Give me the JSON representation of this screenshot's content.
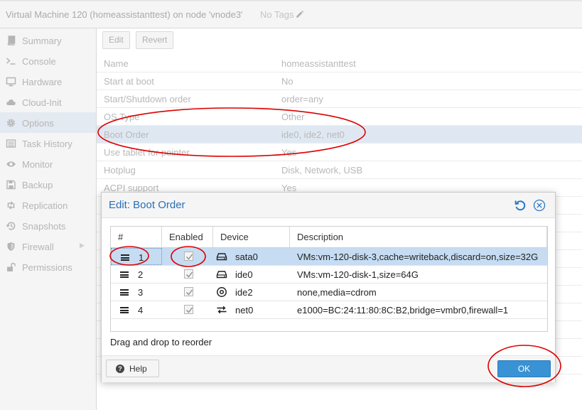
{
  "header": {
    "vm_title": "Virtual Machine 120 (homeassistanttest) on node 'vnode3'",
    "tags_label": "No Tags"
  },
  "nav": {
    "items": [
      {
        "label": "Summary",
        "icon": "book-icon"
      },
      {
        "label": "Console",
        "icon": "terminal-icon"
      },
      {
        "label": "Hardware",
        "icon": "monitor-icon"
      },
      {
        "label": "Cloud-Init",
        "icon": "cloud-icon"
      },
      {
        "label": "Options",
        "icon": "gear-icon"
      },
      {
        "label": "Task History",
        "icon": "list-icon"
      },
      {
        "label": "Monitor",
        "icon": "eye-icon"
      },
      {
        "label": "Backup",
        "icon": "floppy-icon"
      },
      {
        "label": "Replication",
        "icon": "retweet-icon"
      },
      {
        "label": "Snapshots",
        "icon": "history-icon"
      },
      {
        "label": "Firewall",
        "icon": "shield-icon"
      },
      {
        "label": "Permissions",
        "icon": "unlock-icon"
      }
    ],
    "active": "Options"
  },
  "toolbar": {
    "edit_label": "Edit",
    "revert_label": "Revert"
  },
  "options": [
    {
      "key": "Name",
      "value": "homeassistanttest"
    },
    {
      "key": "Start at boot",
      "value": "No"
    },
    {
      "key": "Start/Shutdown order",
      "value": "order=any"
    },
    {
      "key": "OS Type",
      "value": "Other"
    },
    {
      "key": "Boot Order",
      "value": "ide0, ide2, net0"
    },
    {
      "key": "Use tablet for pointer",
      "value": "Yes"
    },
    {
      "key": "Hotplug",
      "value": "Disk, Network, USB"
    },
    {
      "key": "ACPI support",
      "value": "Yes"
    }
  ],
  "dialog": {
    "title": "Edit: Boot Order",
    "columns": {
      "index": "#",
      "enabled": "Enabled",
      "device": "Device",
      "description": "Description"
    },
    "rows": [
      {
        "index": "1",
        "enabled": true,
        "device": "sata0",
        "device_icon": "hdd-icon",
        "description": "VMs:vm-120-disk-3,cache=writeback,discard=on,size=32G"
      },
      {
        "index": "2",
        "enabled": true,
        "device": "ide0",
        "device_icon": "hdd-icon",
        "description": "VMs:vm-120-disk-1,size=64G"
      },
      {
        "index": "3",
        "enabled": true,
        "device": "ide2",
        "device_icon": "cdrom-icon",
        "description": "none,media=cdrom"
      },
      {
        "index": "4",
        "enabled": true,
        "device": "net0",
        "device_icon": "network-exchange-icon",
        "description": "e1000=BC:24:11:80:8C:B2,bridge=vmbr0,firewall=1"
      }
    ],
    "hint": "Drag and drop to reorder",
    "help_label": "Help",
    "ok_label": "OK"
  },
  "colors": {
    "accent": "#3892d4",
    "title_blue": "#2a6fb5",
    "selected_row": "#c6dcf2",
    "annotation_red": "#dd0000"
  }
}
